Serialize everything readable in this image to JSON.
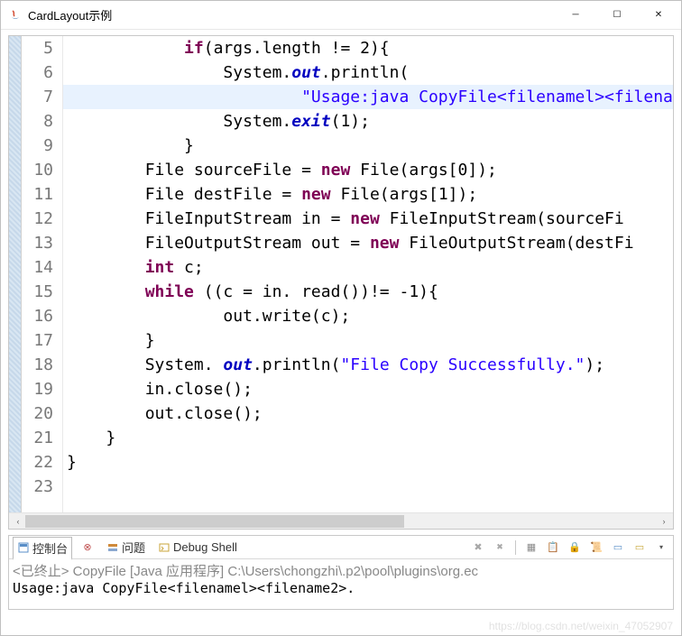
{
  "window": {
    "title": "CardLayout示例",
    "min_label": "─",
    "max_label": "☐",
    "close_label": "✕"
  },
  "editor": {
    "highlighted_line": 7,
    "lines": [
      {
        "n": 5,
        "indent": 3,
        "tokens": [
          [
            "kw",
            "if"
          ],
          [
            "plain",
            "(args.length != "
          ],
          [
            "num",
            "2"
          ],
          [
            "plain",
            "){"
          ]
        ]
      },
      {
        "n": 6,
        "indent": 4,
        "tokens": [
          [
            "plain",
            "System."
          ],
          [
            "static",
            "out"
          ],
          [
            "plain",
            ".println("
          ]
        ]
      },
      {
        "n": 7,
        "indent": 6,
        "tokens": [
          [
            "str",
            "\"Usage:java CopyFile<filenamel><filena"
          ]
        ]
      },
      {
        "n": 8,
        "indent": 4,
        "tokens": [
          [
            "plain",
            "System."
          ],
          [
            "static",
            "exit"
          ],
          [
            "plain",
            "("
          ],
          [
            "num",
            "1"
          ],
          [
            "plain",
            ");"
          ]
        ]
      },
      {
        "n": 9,
        "indent": 3,
        "tokens": [
          [
            "plain",
            "}"
          ]
        ]
      },
      {
        "n": 10,
        "indent": 2,
        "tokens": [
          [
            "plain",
            "File sourceFile = "
          ],
          [
            "kw",
            "new"
          ],
          [
            "plain",
            " File(args["
          ],
          [
            "num",
            "0"
          ],
          [
            "plain",
            "]);"
          ]
        ]
      },
      {
        "n": 11,
        "indent": 2,
        "tokens": [
          [
            "plain",
            "File destFile = "
          ],
          [
            "kw",
            "new"
          ],
          [
            "plain",
            " File(args["
          ],
          [
            "num",
            "1"
          ],
          [
            "plain",
            "]);"
          ]
        ]
      },
      {
        "n": 12,
        "indent": 2,
        "tokens": [
          [
            "plain",
            "FileInputStream in = "
          ],
          [
            "kw",
            "new"
          ],
          [
            "plain",
            " FileInputStream(sourceFi"
          ]
        ]
      },
      {
        "n": 13,
        "indent": 2,
        "tokens": [
          [
            "plain",
            "FileOutputStream out = "
          ],
          [
            "kw",
            "new"
          ],
          [
            "plain",
            " FileOutputStream(destFi"
          ]
        ]
      },
      {
        "n": 14,
        "indent": 2,
        "tokens": [
          [
            "kw",
            "int"
          ],
          [
            "plain",
            " c;"
          ]
        ]
      },
      {
        "n": 15,
        "indent": 2,
        "tokens": [
          [
            "kw",
            "while"
          ],
          [
            "plain",
            " ((c = in. read())!= -"
          ],
          [
            "num",
            "1"
          ],
          [
            "plain",
            "){"
          ]
        ]
      },
      {
        "n": 16,
        "indent": 4,
        "tokens": [
          [
            "plain",
            "out.write(c);"
          ]
        ]
      },
      {
        "n": 17,
        "indent": 2,
        "tokens": [
          [
            "plain",
            "}"
          ]
        ]
      },
      {
        "n": 18,
        "indent": 2,
        "tokens": [
          [
            "plain",
            "System. "
          ],
          [
            "static",
            "out"
          ],
          [
            "plain",
            ".println("
          ],
          [
            "str",
            "\"File Copy Successfully.\""
          ],
          [
            "plain",
            ");"
          ]
        ]
      },
      {
        "n": 19,
        "indent": 2,
        "tokens": [
          [
            "plain",
            "in.close();"
          ]
        ]
      },
      {
        "n": 20,
        "indent": 2,
        "tokens": [
          [
            "plain",
            "out.close();"
          ]
        ]
      },
      {
        "n": 21,
        "indent": 1,
        "tokens": [
          [
            "plain",
            "}"
          ]
        ]
      },
      {
        "n": 22,
        "indent": 0,
        "tokens": [
          [
            "plain",
            "}"
          ]
        ]
      },
      {
        "n": 23,
        "indent": 0,
        "tokens": []
      }
    ],
    "hscroll_left": "‹",
    "hscroll_right": "›"
  },
  "console": {
    "tabs": {
      "console_label": "控制台",
      "problems_label": "问题",
      "debug_label": "Debug Shell"
    },
    "toolbar": {
      "b1": "✖",
      "b2": "✖",
      "b3": "▦",
      "b4": "📋",
      "b5": "🔒",
      "b6": "📜",
      "b7": "▭",
      "b8": "▭",
      "b9": "▾"
    },
    "line1": "<已终止> CopyFile [Java 应用程序] C:\\Users\\chongzhi\\.p2\\pool\\plugins\\org.ec",
    "line2": "Usage:java CopyFile<filenamel><filename2>."
  },
  "watermark": "https://blog.csdn.net/weixin_47052907"
}
